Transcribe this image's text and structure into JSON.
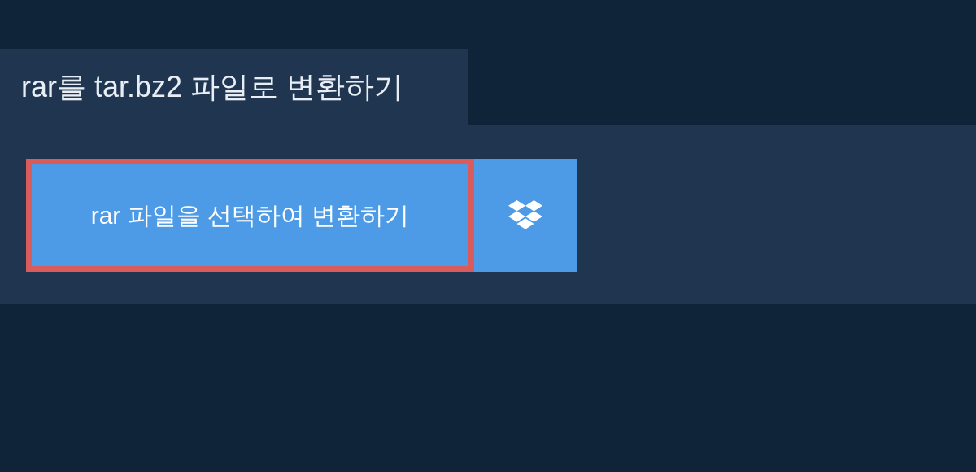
{
  "tab": {
    "title": "rar를 tar.bz2 파일로 변환하기"
  },
  "actions": {
    "select_button": "rar 파일을 선택하여 변환하기"
  }
}
